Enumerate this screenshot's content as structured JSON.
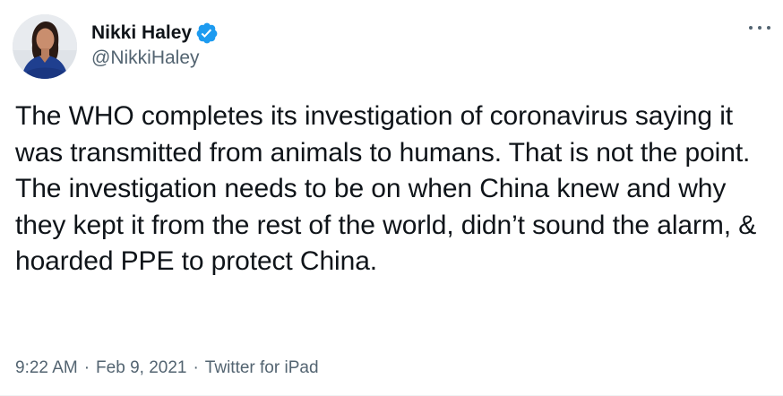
{
  "author": {
    "display_name": "Nikki Haley",
    "handle": "@NikkiHaley",
    "verified": true,
    "avatar_icon": "profile-photo"
  },
  "tweet": {
    "text": "The WHO completes its investigation of coronavirus saying it was transmitted from animals to humans. That is not the point. The investigation needs to be on when China knew and why they kept it from the rest of the world, didn’t sound the alarm, & hoarded PPE to protect China.",
    "time": "9:22 AM",
    "separator": "·",
    "date": "Feb 9, 2021",
    "source": "Twitter for iPad"
  },
  "colors": {
    "verified_badge": "#1d9bf0",
    "secondary_text": "#536471",
    "primary_text": "#0f1419"
  },
  "icons": {
    "more": "more-horizontal-icon",
    "verified": "verified-badge-icon"
  }
}
